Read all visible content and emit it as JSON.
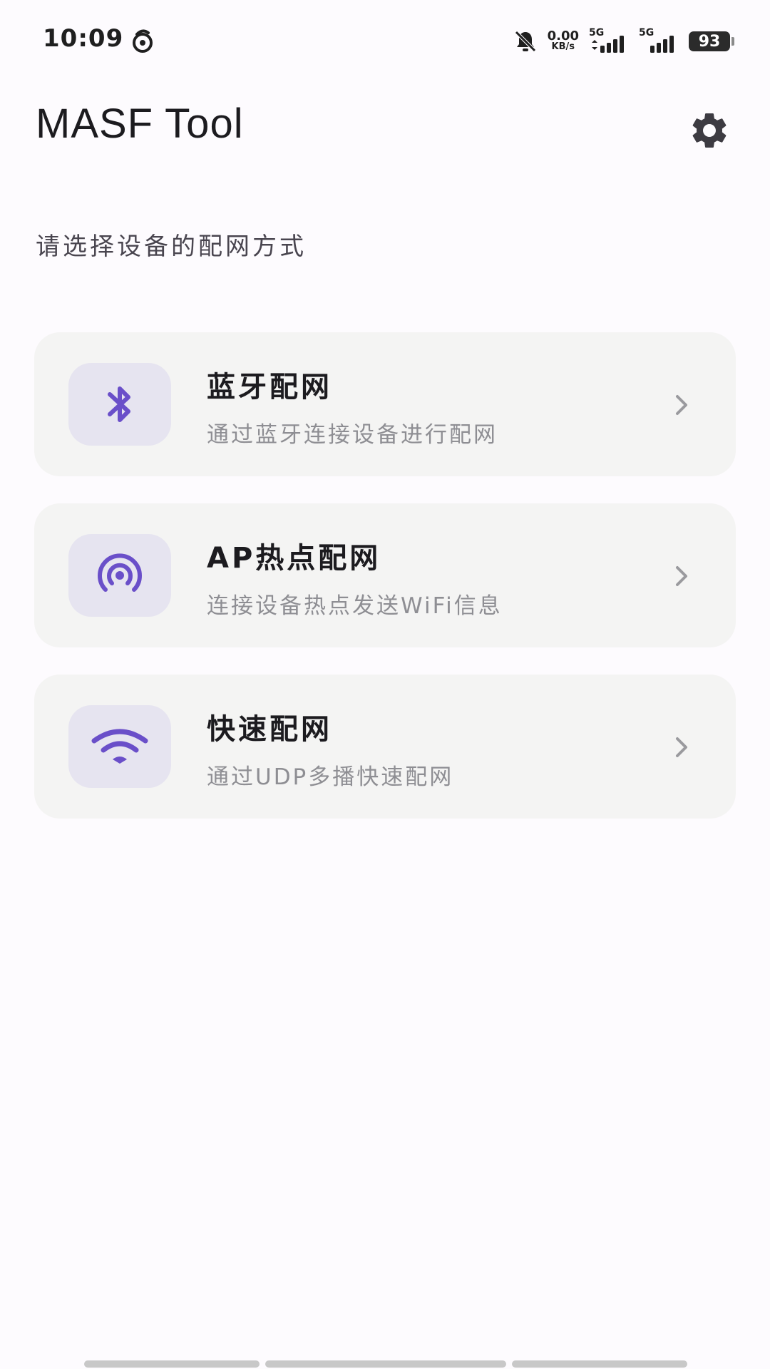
{
  "status_bar": {
    "time": "10:09",
    "net_speed_value": "0.00",
    "net_speed_unit": "KB/s",
    "signal1_label": "5G",
    "signal2_label": "5G",
    "battery_level": "93"
  },
  "header": {
    "title": "MASF Tool"
  },
  "subtitle": "请选择设备的配网方式",
  "options": [
    {
      "title": "蓝牙配网",
      "description": "通过蓝牙连接设备进行配网",
      "icon": "bluetooth-icon"
    },
    {
      "title": "AP热点配网",
      "description": "连接设备热点发送WiFi信息",
      "icon": "hotspot-icon"
    },
    {
      "title": "快速配网",
      "description": "通过UDP多播快速配网",
      "icon": "wifi-icon"
    }
  ],
  "colors": {
    "accent": "#6a4fc9",
    "card_background": "#f4f4f3",
    "icon_background": "#e6e4f0",
    "page_background": "#fdfbfe"
  }
}
